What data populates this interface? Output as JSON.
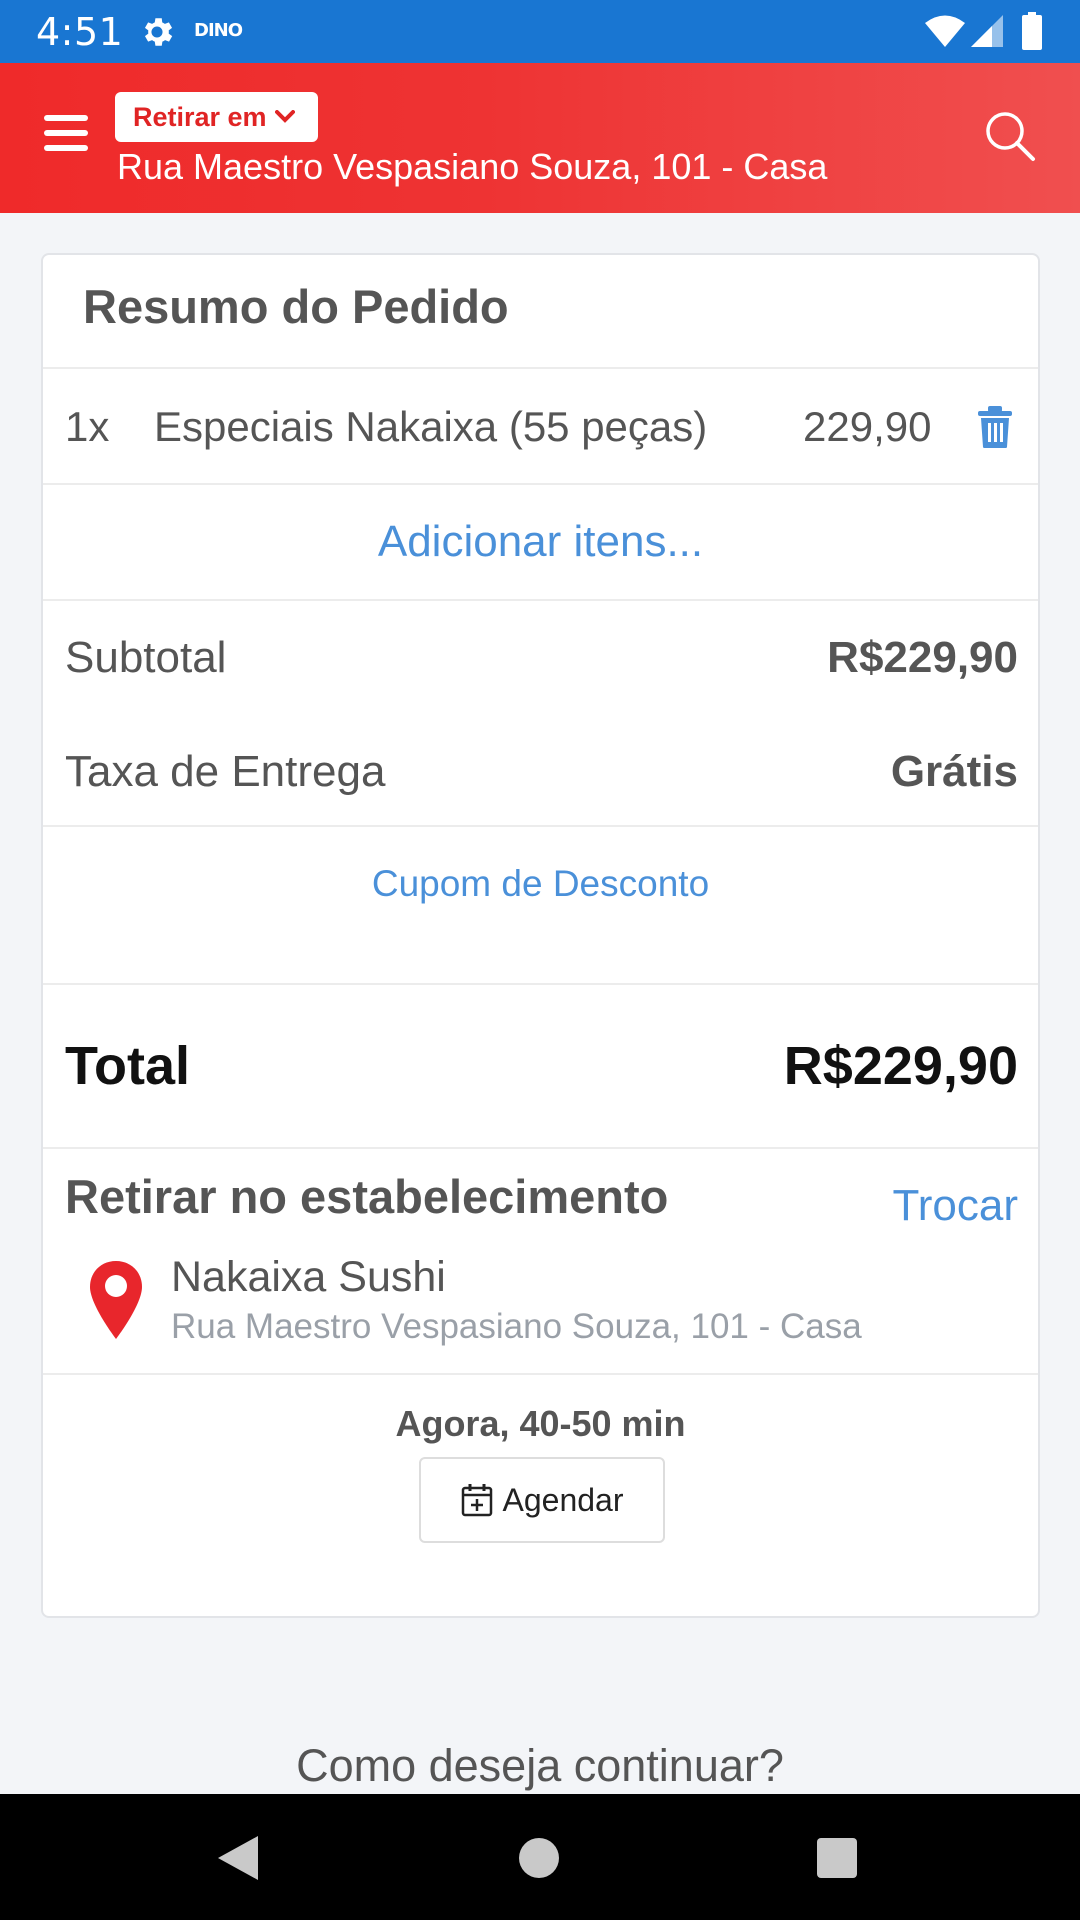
{
  "status_bar": {
    "time": "4:51",
    "app_badge": "DINO"
  },
  "header": {
    "mode_label": "Retirar em",
    "address": "Rua Maestro Vespasiano Souza, 101 - Casa"
  },
  "summary": {
    "title": "Resumo do Pedido",
    "items": [
      {
        "qty": "1x",
        "name": "Especiais Nakaixa (55 peças)",
        "price": "229,90"
      }
    ],
    "add_items_label": "Adicionar itens...",
    "subtotal_label": "Subtotal",
    "subtotal_value": "R$229,90",
    "delivery_fee_label": "Taxa de Entrega",
    "delivery_fee_value": "Grátis",
    "coupon_label": "Cupom de Desconto",
    "total_label": "Total",
    "total_value": "R$229,90"
  },
  "pickup": {
    "title": "Retirar no estabelecimento",
    "change_label": "Trocar",
    "store_name": "Nakaixa Sushi",
    "store_address": "Rua Maestro Vespasiano Souza, 101 - Casa",
    "eta": "Agora, 40-50 min",
    "schedule_label": "Agendar"
  },
  "footer": {
    "continue_prompt": "Como deseja continuar?"
  },
  "colors": {
    "status_bar": "#1976d2",
    "header_red": "#ef2a2a",
    "link_blue": "#4a90d9",
    "pin_red": "#e8262c"
  }
}
